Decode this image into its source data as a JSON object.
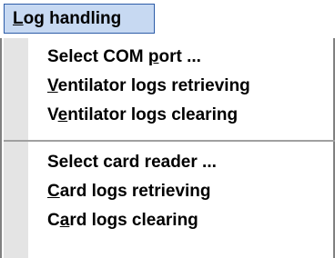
{
  "menu": {
    "title": "Log handling",
    "title_mnemonic": "L",
    "title_rest": "og handling"
  },
  "groups": [
    {
      "items": [
        {
          "label": "Select COM port ...",
          "mnemonic": "p"
        },
        {
          "label": "Ventilator logs retrieving",
          "mnemonic": "V"
        },
        {
          "label": "Ventilator logs clearing",
          "mnemonic": "e"
        }
      ]
    },
    {
      "items": [
        {
          "label": "Select card reader ...",
          "mnemonic": ""
        },
        {
          "label": "Card logs retrieving",
          "mnemonic": "C"
        },
        {
          "label": "Card logs clearing",
          "mnemonic": "a"
        }
      ]
    }
  ],
  "colors": {
    "title_highlight_bg": "#c7d9f2",
    "title_highlight_border": "#2c5ca8",
    "gutter": "#e4e4e4",
    "border": "#808080"
  }
}
